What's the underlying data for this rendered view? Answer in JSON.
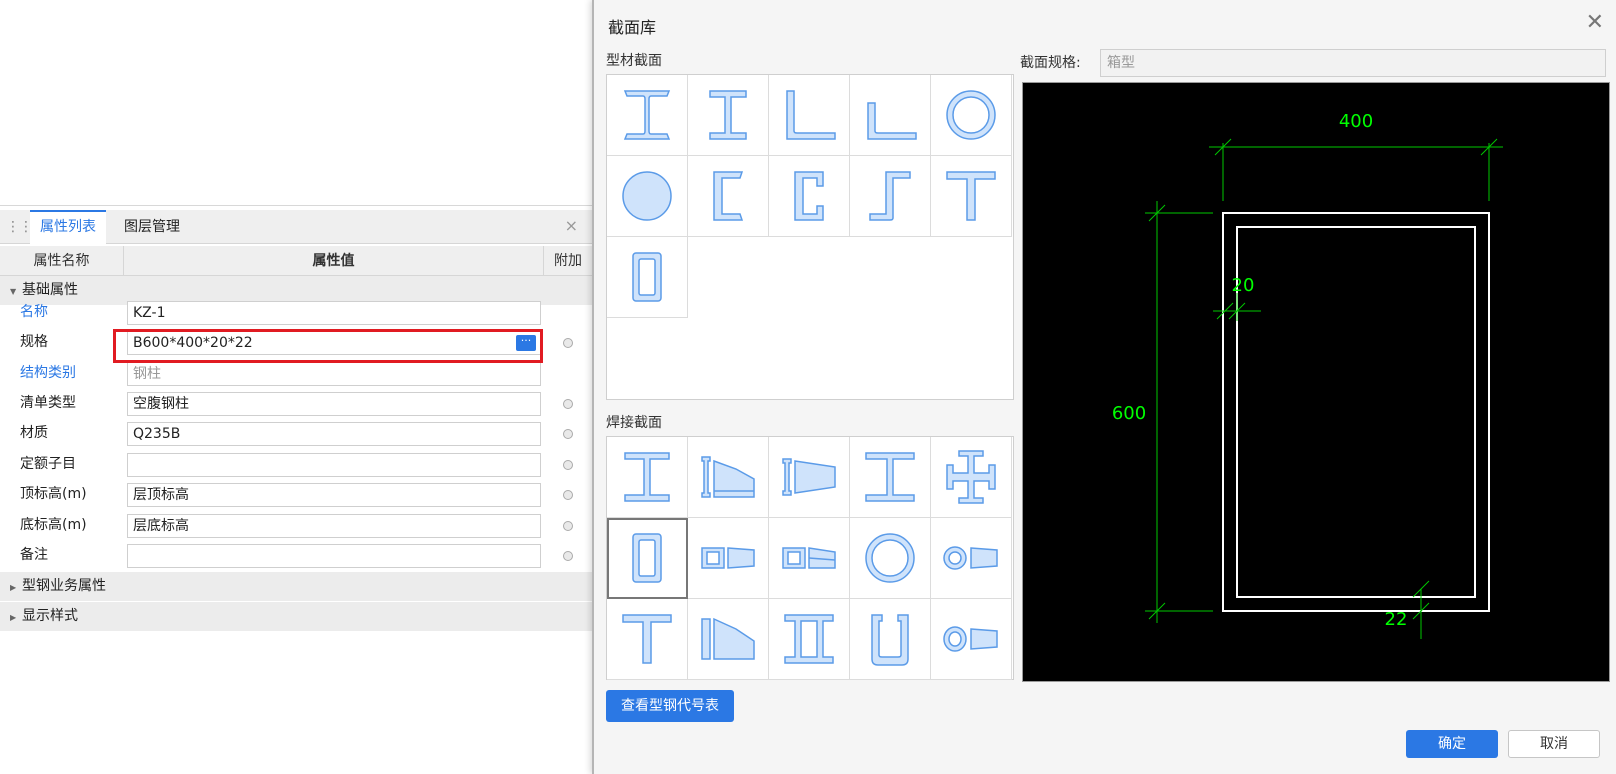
{
  "panel": {
    "tabs": [
      "属性列表",
      "图层管理"
    ],
    "close_glyph": "×",
    "grip_glyph": "⋮⋮",
    "headers": {
      "name": "属性名称",
      "value": "属性值",
      "extra": "附加"
    },
    "groups": {
      "basic": "基础属性",
      "steel": "型钢业务属性",
      "display": "显示样式"
    },
    "rows": [
      {
        "name": "名称",
        "value": "KZ-1"
      },
      {
        "name": "规格",
        "value": "B600*400*20*22"
      },
      {
        "name": "结构类别",
        "value": "钢柱"
      },
      {
        "name": "清单类型",
        "value": "空腹钢柱"
      },
      {
        "name": "材质",
        "value": "Q235B"
      },
      {
        "name": "定额子目",
        "value": ""
      },
      {
        "name": "顶标高(m)",
        "value": "层顶标高"
      },
      {
        "name": "底标高(m)",
        "value": "层底标高"
      },
      {
        "name": "备注",
        "value": ""
      }
    ],
    "ellipsis": "···"
  },
  "dialog": {
    "title": "截面库",
    "close_glyph": "✕",
    "section_profile": "型材截面",
    "section_welded": "焊接截面",
    "spec_label": "截面规格:",
    "spec_value": "箱型",
    "btn_codes": "查看型钢代号表",
    "btn_ok": "确定",
    "btn_cancel": "取消"
  },
  "preview": {
    "dims": {
      "width": "400",
      "height": "600",
      "web": "20",
      "flange": "22"
    },
    "colors": {
      "background": "#000000",
      "section": "#ffffff",
      "dimension": "#00c800",
      "dimension_text": "#00ff00"
    }
  },
  "colors": {
    "accent": "#2b78e4",
    "highlight": "#e11b22",
    "icon_fill": "#cfe3fb",
    "icon_stroke": "#5b9be8"
  },
  "icons": {
    "profile": [
      "i-beam-icon",
      "h-beam-icon",
      "equal-angle-icon",
      "unequal-angle-icon",
      "pipe-icon",
      "round-bar-icon",
      "channel-lipless-icon",
      "channel-lipped-icon",
      "z-section-icon",
      "t-section-icon",
      "box-section-icon"
    ],
    "welded": [
      "welded-i-icon",
      "tapered-i-left-icon",
      "tapered-i-right-icon",
      "welded-h-icon",
      "cross-section-icon",
      "welded-box-icon",
      "box-tapered-icon",
      "box-tapered-2-icon",
      "welded-pipe-icon",
      "pipe-tapered-icon",
      "welded-t-icon",
      "tapered-t-icon",
      "double-i-icon",
      "u-section-icon",
      "pipe-tapered-2-icon"
    ]
  }
}
